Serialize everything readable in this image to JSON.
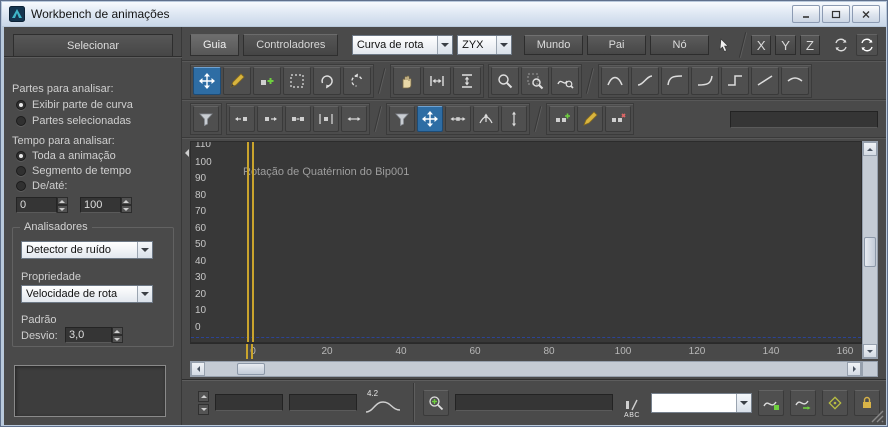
{
  "window": {
    "title": "Workbench de animações"
  },
  "sidebar": {
    "tab_label": "Selecionar",
    "partes_label": "Partes para analisar:",
    "partes_options": [
      "Exibir parte de curva",
      "Partes selecionadas"
    ],
    "partes_selected_index": 0,
    "tempo_label": "Tempo para analisar:",
    "tempo_options": [
      "Toda a animação",
      "Segmento de tempo",
      "De/até:"
    ],
    "tempo_selected_index": 0,
    "de_value": "0",
    "ate_value": "100",
    "analisadores_label": "Analisadores",
    "analisador_value": "Detector de ruído",
    "propriedade_label": "Propriedade",
    "propriedade_value": "Velocidade de rota",
    "padrao_label": "Padrão",
    "desvio_label": "Desvio:",
    "desvio_value": "3,0"
  },
  "topbar": {
    "tab_guia": "Guia",
    "tab_controladores": "Controladores",
    "curve_type_value": "Curva de rota",
    "rot_order_value": "ZYX",
    "btn_mundo": "Mundo",
    "btn_pai": "Pai",
    "btn_no": "Nó",
    "axis_x": "X",
    "axis_y": "Y",
    "axis_z": "Z"
  },
  "curve_editor": {
    "annotation": "Rotação de Quatérnion do Bip001",
    "y_labels": [
      "110",
      "100",
      "90",
      "80",
      "70",
      "60",
      "50",
      "40",
      "30",
      "20",
      "10",
      "0"
    ],
    "x_labels": [
      "0",
      "20",
      "40",
      "60",
      "80",
      "100",
      "120",
      "140",
      "160"
    ],
    "time_slider_frame": 0
  },
  "statusbar": {
    "key_time_value": "",
    "key_value_value": "",
    "stats_label": "4.2",
    "track_name_value": "",
    "abc_label": "ABC",
    "selection_dropdown_value": ""
  },
  "colors": {
    "accent_blue": "#2e6da4",
    "time_slider_yellow": "#c9a42d",
    "zero_line_blue": "#2b4496"
  }
}
